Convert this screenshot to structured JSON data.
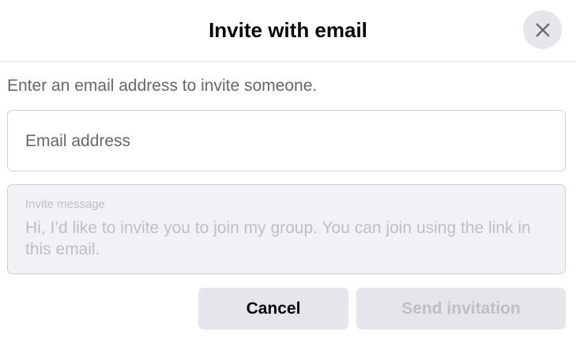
{
  "dialog": {
    "title": "Invite with email",
    "close_icon": "close-icon",
    "description": "Enter an email address to invite someone.",
    "email": {
      "placeholder": "Email address",
      "value": ""
    },
    "message": {
      "label": "Invite message",
      "placeholder": "Hi, I’d like to invite you to join my group. You can join using the link in this email."
    },
    "buttons": {
      "cancel_label": "Cancel",
      "send_label": "Send invitation"
    }
  },
  "colors": {
    "background": "#ffffff",
    "divider": "#dadde1",
    "button_bg": "#e4e6eb",
    "disabled_text": "#bcc0c4",
    "secondary_text": "#65676b",
    "input_disabled_bg": "#f0f2f5"
  }
}
